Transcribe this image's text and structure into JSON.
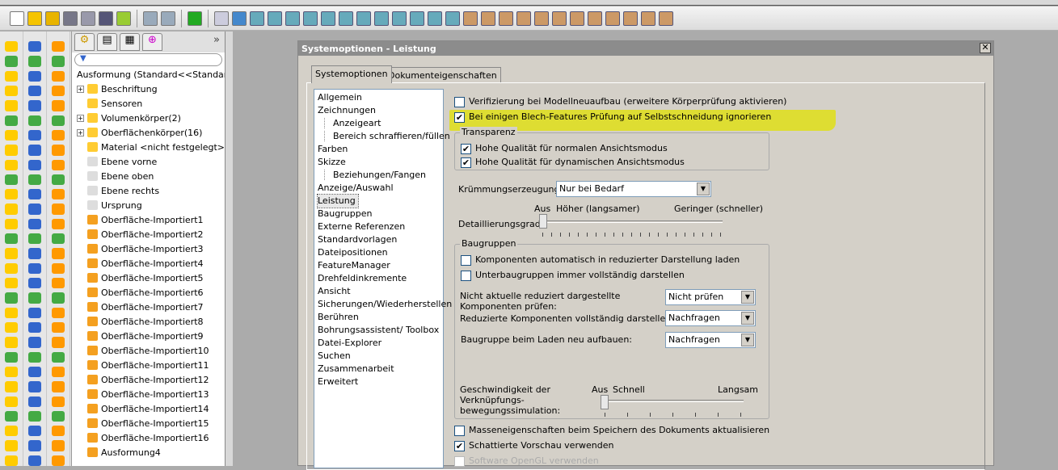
{
  "toolbar": {
    "icons": [
      "new-document",
      "open",
      "rebuild",
      "print",
      "zoom-to-fit",
      "properties",
      "options",
      "undo",
      "redo",
      "traffic-light",
      "select",
      "view-cube"
    ]
  },
  "tree": {
    "tabs": [
      "feature-manager",
      "property-manager",
      "configuration-manager",
      "dim-xpert"
    ],
    "filter_icon": "filter-icon",
    "items": [
      {
        "label": "Ausformung  (Standard<<Standar",
        "expand": ""
      },
      {
        "label": "Beschriftung",
        "expand": "+"
      },
      {
        "label": "Sensoren",
        "expand": ""
      },
      {
        "label": "Volumenkörper(2)",
        "expand": "+"
      },
      {
        "label": "Oberflächenkörper(16)",
        "expand": "+"
      },
      {
        "label": "Material <nicht festgelegt>",
        "expand": ""
      },
      {
        "label": "Ebene vorne",
        "expand": ""
      },
      {
        "label": "Ebene oben",
        "expand": ""
      },
      {
        "label": "Ebene rechts",
        "expand": ""
      },
      {
        "label": "Ursprung",
        "expand": ""
      },
      {
        "label": "Oberfläche-Importiert1",
        "expand": ""
      },
      {
        "label": "Oberfläche-Importiert2",
        "expand": ""
      },
      {
        "label": "Oberfläche-Importiert3",
        "expand": ""
      },
      {
        "label": "Oberfläche-Importiert4",
        "expand": ""
      },
      {
        "label": "Oberfläche-Importiert5",
        "expand": ""
      },
      {
        "label": "Oberfläche-Importiert6",
        "expand": ""
      },
      {
        "label": "Oberfläche-Importiert7",
        "expand": ""
      },
      {
        "label": "Oberfläche-Importiert8",
        "expand": ""
      },
      {
        "label": "Oberfläche-Importiert9",
        "expand": ""
      },
      {
        "label": "Oberfläche-Importiert10",
        "expand": ""
      },
      {
        "label": "Oberfläche-Importiert11",
        "expand": ""
      },
      {
        "label": "Oberfläche-Importiert12",
        "expand": ""
      },
      {
        "label": "Oberfläche-Importiert13",
        "expand": ""
      },
      {
        "label": "Oberfläche-Importiert14",
        "expand": ""
      },
      {
        "label": "Oberfläche-Importiert15",
        "expand": ""
      },
      {
        "label": "Oberfläche-Importiert16",
        "expand": ""
      },
      {
        "label": "Ausformung4",
        "expand": ""
      }
    ]
  },
  "dialog": {
    "title": "Systemoptionen - Leistung",
    "close": "✕",
    "tabs": [
      "Systemoptionen",
      "Dokumenteigenschaften"
    ],
    "categories": [
      {
        "label": "Allgemein",
        "sub": false
      },
      {
        "label": "Zeichnungen",
        "sub": false
      },
      {
        "label": "Anzeigeart",
        "sub": true
      },
      {
        "label": "Bereich schraffieren/füllen",
        "sub": true
      },
      {
        "label": "Farben",
        "sub": false
      },
      {
        "label": "Skizze",
        "sub": false
      },
      {
        "label": "Beziehungen/Fangen",
        "sub": true
      },
      {
        "label": "Anzeige/Auswahl",
        "sub": false
      },
      {
        "label": "Leistung",
        "sub": false,
        "selected": true
      },
      {
        "label": "Baugruppen",
        "sub": false
      },
      {
        "label": "Externe Referenzen",
        "sub": false
      },
      {
        "label": "Standardvorlagen",
        "sub": false
      },
      {
        "label": "Dateipositionen",
        "sub": false
      },
      {
        "label": "FeatureManager",
        "sub": false
      },
      {
        "label": "Drehfeldinkremente",
        "sub": false
      },
      {
        "label": "Ansicht",
        "sub": false
      },
      {
        "label": "Sicherungen/Wiederherstellen",
        "sub": false
      },
      {
        "label": "Berühren",
        "sub": false
      },
      {
        "label": "Bohrungsassistent/ Toolbox",
        "sub": false
      },
      {
        "label": "Datei-Explorer",
        "sub": false
      },
      {
        "label": "Suchen",
        "sub": false
      },
      {
        "label": "Zusammenarbeit",
        "sub": false
      },
      {
        "label": "Erweitert",
        "sub": false
      }
    ],
    "verify": {
      "label": "Verifizierung bei Modellneuaufbau (erweitere Körperprüfung aktivieren)",
      "checked": false
    },
    "sheetmetal": {
      "label": "Bei einigen Blech-Features Prüfung auf Selbstschneidung ignorieren",
      "checked": true,
      "highlight": "#e1e100"
    },
    "transparency": {
      "title": "Transparenz",
      "normal": {
        "label": "Hohe Qualität für normalen Ansichtsmodus",
        "checked": true
      },
      "dynamic": {
        "label": "Hohe Qualität für dynamischen Ansichtsmodus",
        "checked": true
      }
    },
    "curvature": {
      "label": "Krümmungserzeugung:",
      "value": "Nur bei Bedarf"
    },
    "detail": {
      "label": "Detaillierungsgrad:",
      "off": "Aus",
      "high": "Höher (langsamer)",
      "low": "Geringer (schneller)",
      "value": 0
    },
    "assemblies": {
      "title": "Baugruppen",
      "auto_light": {
        "label": "Komponenten automatisch in reduzierter Darstellung laden",
        "checked": false
      },
      "sub_full": {
        "label": "Unterbaugruppen immer vollständig darstellen",
        "checked": false
      },
      "check_outdated": {
        "label1": "Nicht aktuelle reduziert dargestellte",
        "label2": "Komponenten prüfen:",
        "value": "Nicht prüfen"
      },
      "resolve": {
        "label": "Reduzierte Komponenten vollständig darstellen:",
        "value": "Nachfragen"
      },
      "rebuild": {
        "label": "Baugruppe beim Laden neu aufbauen:",
        "value": "Nachfragen"
      },
      "mate_speed": {
        "label1": "Geschwindigkeit der",
        "label2": "Verknüpfungs-",
        "label3": "bewegungssimulation:",
        "off": "Aus",
        "fast": "Schnell",
        "slow": "Langsam",
        "value": 0
      }
    },
    "mass": {
      "label": "Masseneigenschaften beim Speichern des Dokuments aktualisieren",
      "checked": false
    },
    "shaded": {
      "label": "Schattierte Vorschau verwenden",
      "checked": true
    },
    "opengl": {
      "label": "Software OpenGL verwenden",
      "checked": false,
      "disabled": true
    }
  }
}
